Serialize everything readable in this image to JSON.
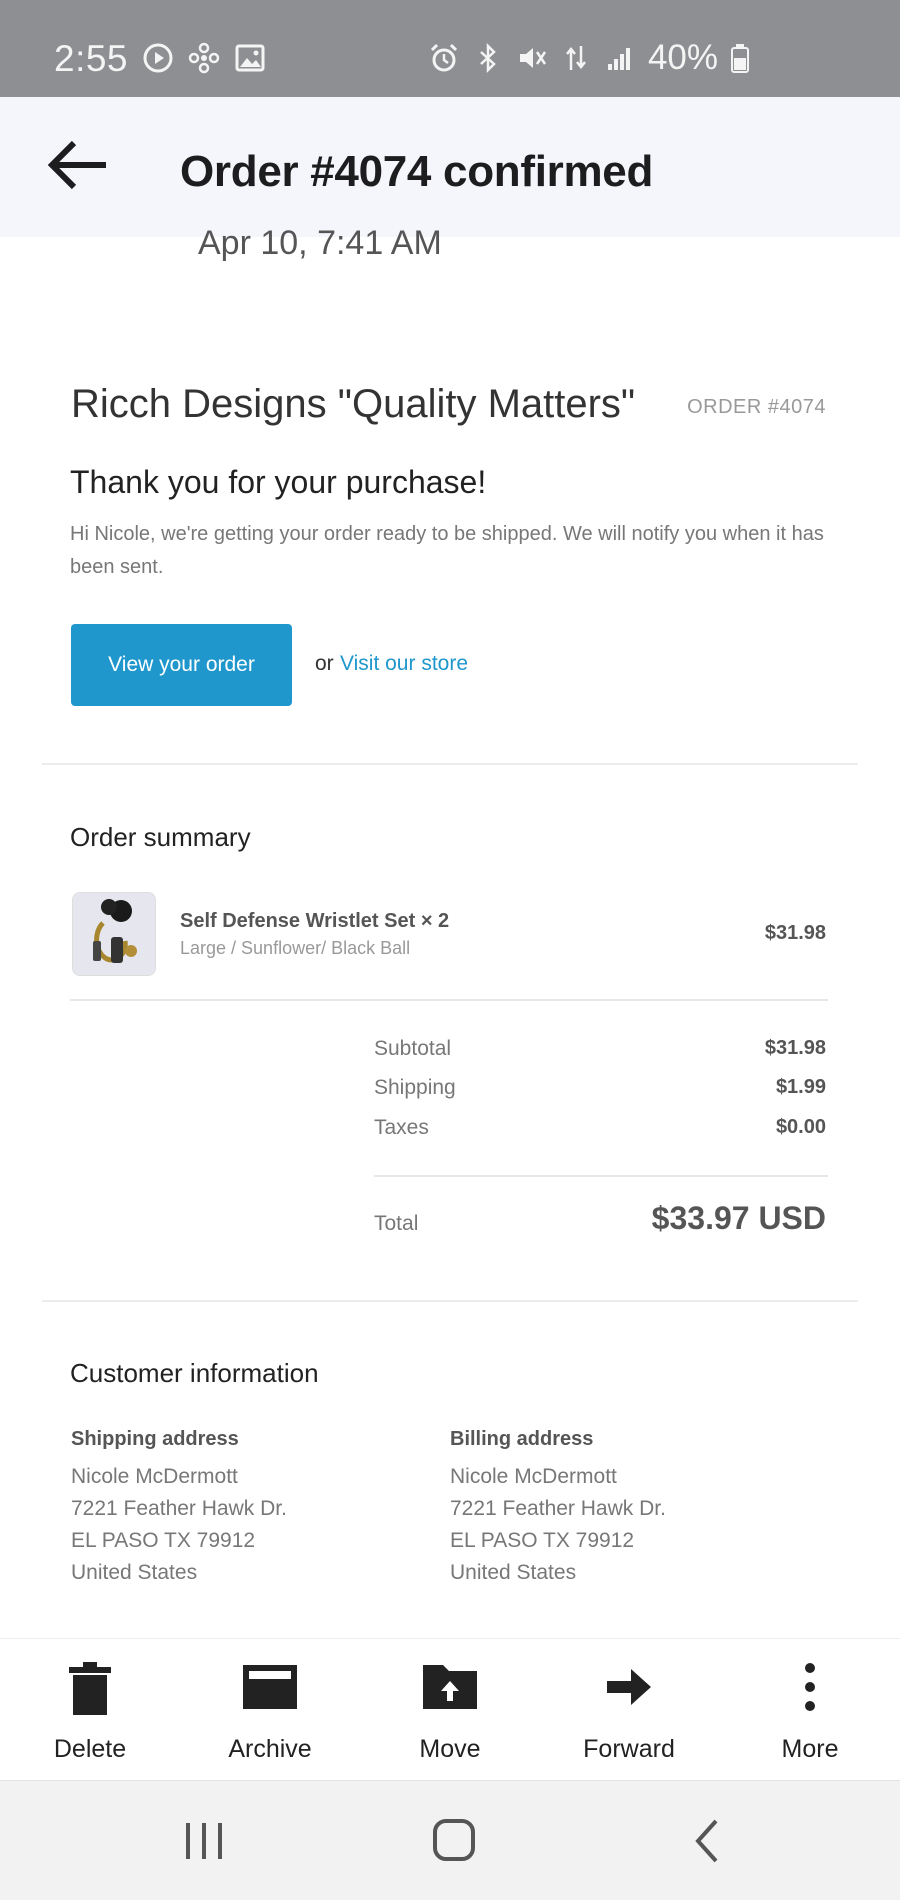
{
  "status_bar": {
    "time": "2:55",
    "battery": "40%",
    "icons": [
      "media-play-icon",
      "pinwheel-icon",
      "image-icon",
      "alarm-icon",
      "bluetooth-icon",
      "mute-icon",
      "data-transfer-icon",
      "signal-icon",
      "battery-icon"
    ]
  },
  "header": {
    "title": "Order #4074 confirmed",
    "back_icon": "back-arrow-icon"
  },
  "email": {
    "date": "Apr 10, 7:41 AM",
    "shop_name": "Ricch Designs \"Quality Matters\"",
    "order_number": "ORDER #4074",
    "thanks": "Thank you for your purchase!",
    "intro": "Hi Nicole, we're getting your order ready to be shipped. We will notify you when it has been sent.",
    "view_order": "View your order",
    "or": "or",
    "visit_store": "Visit our store"
  },
  "order_summary": {
    "title": "Order summary",
    "item": {
      "name": "Self Defense Wristlet Set × 2",
      "variant": "Large / Sunflower/ Black Ball",
      "price": "$31.98"
    },
    "subtotal_label": "Subtotal",
    "subtotal": "$31.98",
    "shipping_label": "Shipping",
    "shipping": "$1.99",
    "taxes_label": "Taxes",
    "taxes": "$0.00",
    "total_label": "Total",
    "total": "$33.97 USD"
  },
  "customer": {
    "title": "Customer information",
    "shipping": {
      "heading": "Shipping address",
      "name": "Nicole McDermott",
      "street": "7221 Feather Hawk Dr.",
      "city": "EL PASO TX 79912",
      "country": "United States"
    },
    "billing": {
      "heading": "Billing address",
      "name": "Nicole McDermott",
      "street": "7221 Feather Hawk Dr.",
      "city": "EL PASO TX 79912",
      "country": "United States"
    }
  },
  "actions": {
    "delete": "Delete",
    "archive": "Archive",
    "move": "Move",
    "forward": "Forward",
    "more": "More"
  },
  "colors": {
    "accent": "#1f97cd",
    "status_bar": "#8e8f93",
    "header_bg": "#f4f6fc"
  }
}
